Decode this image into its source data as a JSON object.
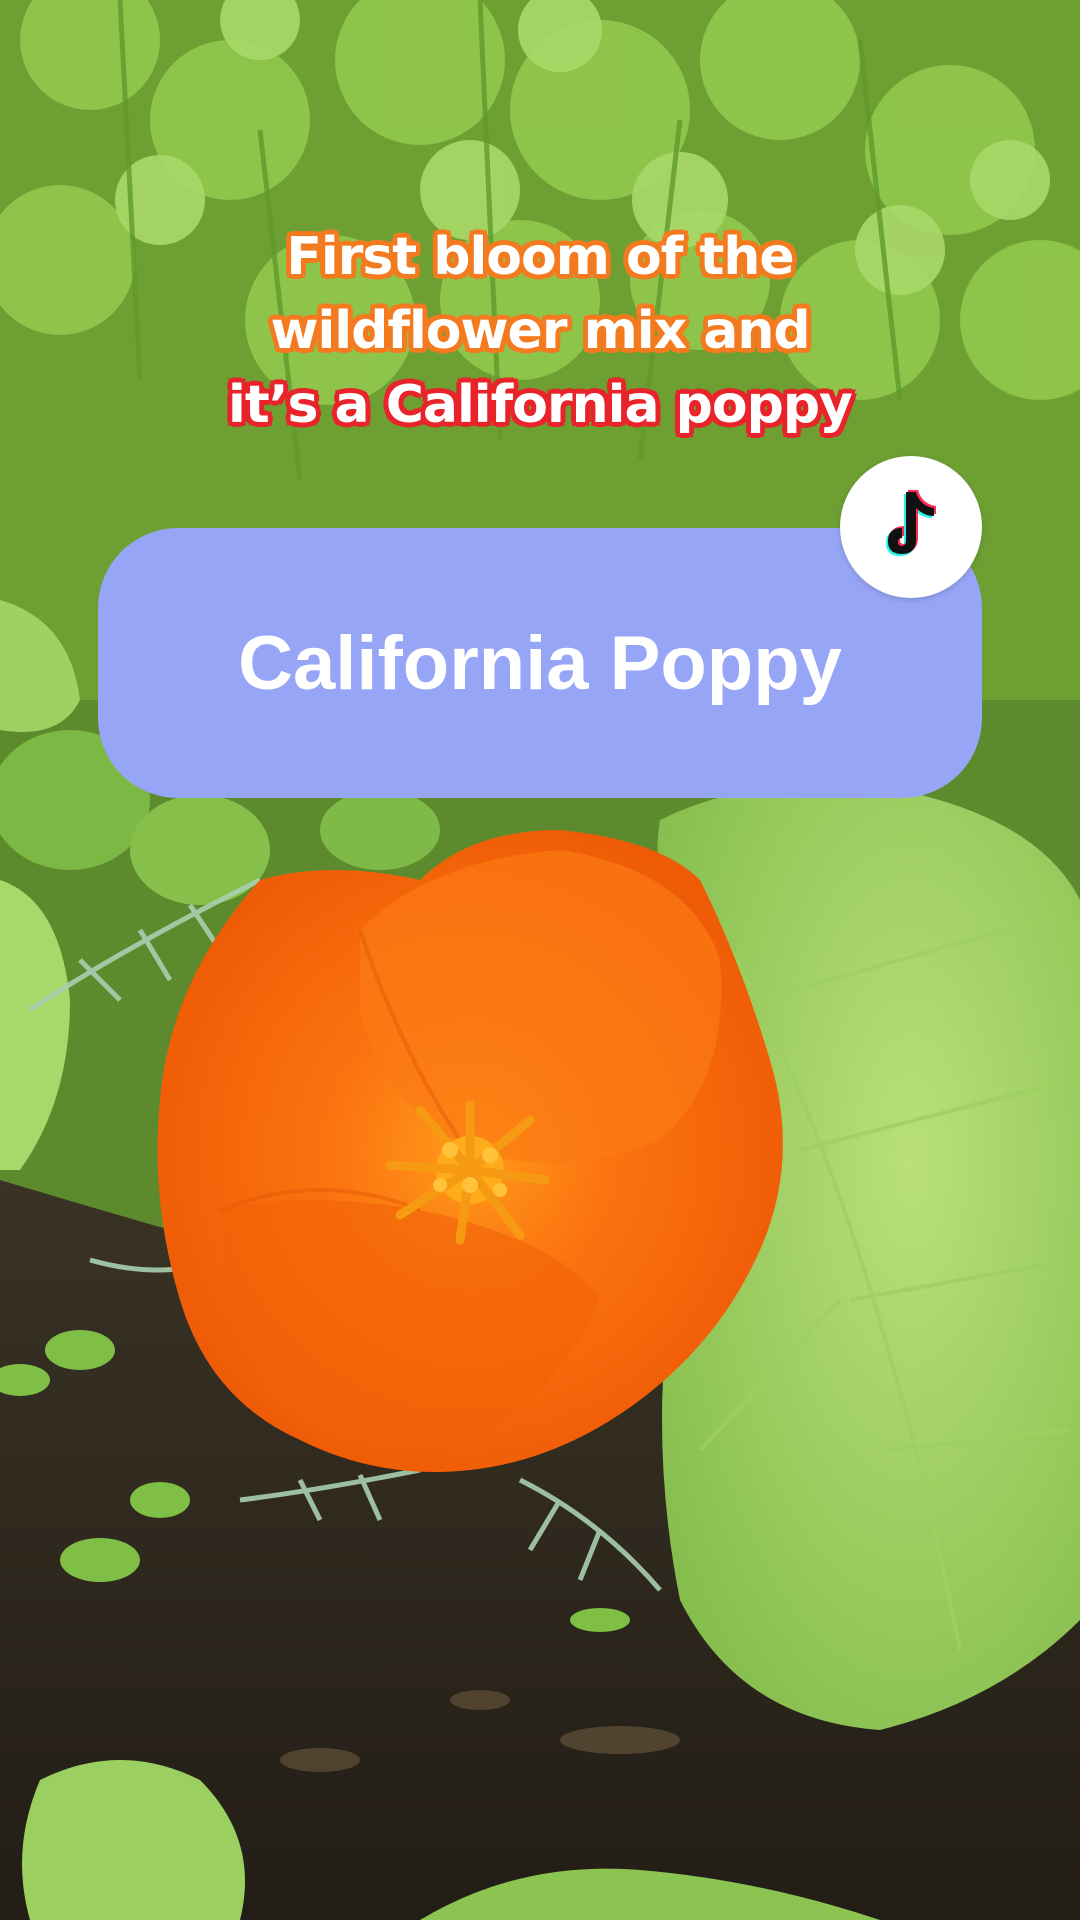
{
  "caption": {
    "line1": "First bloom of the",
    "line2": "wildflower mix and",
    "line3": "it’s a California poppy"
  },
  "sticker": {
    "label": "California Poppy",
    "color": "#97a5f6"
  },
  "badge": {
    "icon": "tiktok-logo-icon"
  },
  "colors": {
    "caption_outline_orange": "#f47a1f",
    "caption_outline_red": "#e8232a",
    "poppy_orange": "#f76a0c"
  }
}
